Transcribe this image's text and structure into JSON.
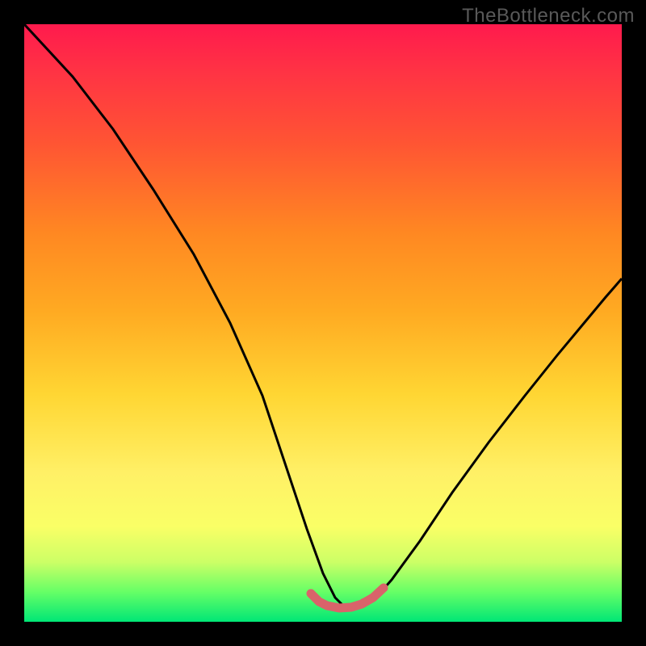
{
  "watermark": "TheBottleneck.com",
  "chart_data": {
    "type": "line",
    "title": "",
    "xlabel": "",
    "ylabel": "",
    "xlim": [
      0,
      100
    ],
    "ylim": [
      0,
      100
    ],
    "series": [
      {
        "name": "curve",
        "x": [
          0,
          5,
          10,
          15,
          20,
          25,
          30,
          35,
          40,
          45,
          48,
          50,
          52,
          55,
          58,
          60,
          65,
          70,
          75,
          80,
          85,
          90,
          95,
          100
        ],
        "values": [
          100,
          90,
          80,
          70,
          60,
          50,
          40,
          30,
          20,
          10,
          3,
          2,
          2,
          3,
          5,
          8,
          15,
          23,
          32,
          40,
          48,
          55,
          60,
          63
        ]
      },
      {
        "name": "valley-highlight",
        "x": [
          45,
          47,
          49,
          51,
          53,
          55,
          57,
          59
        ],
        "values": [
          5,
          3,
          2,
          2,
          2.5,
          3,
          4,
          6
        ]
      }
    ],
    "colors": {
      "curve": "#000000",
      "valley_highlight": "#d9636a",
      "gradient_top": "#ff1a4d",
      "gradient_bottom": "#00e676",
      "frame": "#000000",
      "watermark": "#595959"
    }
  }
}
